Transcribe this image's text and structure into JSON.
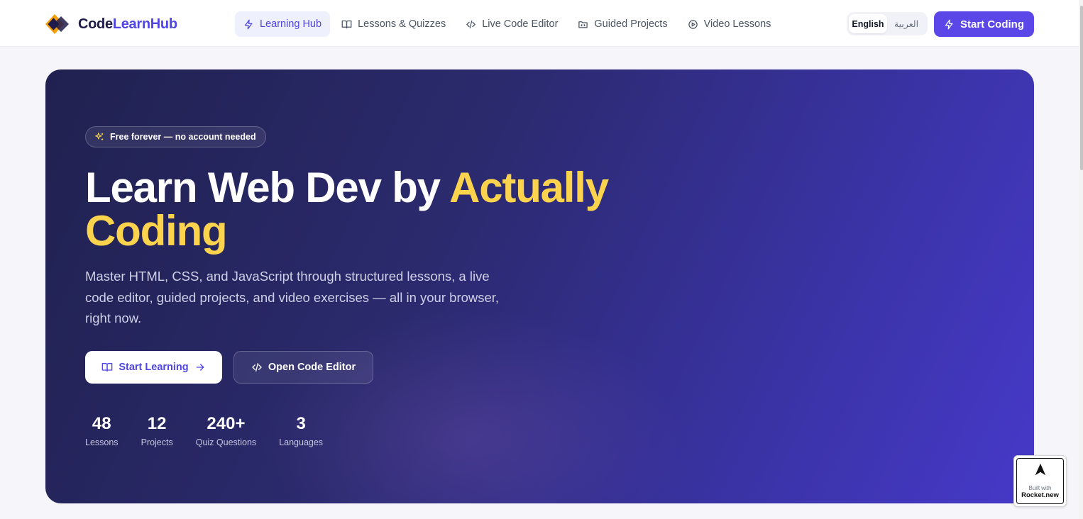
{
  "header": {
    "logo": {
      "part1": "Code",
      "part2": "LearnHub"
    },
    "nav": [
      {
        "label": "Learning Hub",
        "icon": "bolt-icon",
        "active": true
      },
      {
        "label": "Lessons & Quizzes",
        "icon": "book-open-icon",
        "active": false
      },
      {
        "label": "Live Code Editor",
        "icon": "code-icon",
        "active": false
      },
      {
        "label": "Guided Projects",
        "icon": "folder-code-icon",
        "active": false
      },
      {
        "label": "Video Lessons",
        "icon": "play-circle-icon",
        "active": false
      }
    ],
    "languages": {
      "english": "English",
      "arabic": "العربية",
      "selected": "English"
    },
    "cta_label": "Start Coding"
  },
  "hero": {
    "badge": "Free forever — no account needed",
    "title_line1": "Learn Web Dev by ",
    "title_highlight1": "Actually",
    "title_highlight2": "Coding",
    "subtitle": "Master HTML, CSS, and JavaScript through structured lessons, a live code editor, guided projects, and video exercises — all in your browser, right now.",
    "primary_button": "Start Learning",
    "secondary_button": "Open Code Editor",
    "stats": [
      {
        "value": "48",
        "label": "Lessons"
      },
      {
        "value": "12",
        "label": "Projects"
      },
      {
        "value": "240+",
        "label": "Quiz Questions"
      },
      {
        "value": "3",
        "label": "Languages"
      }
    ]
  },
  "widget": {
    "small": "Built with",
    "name": "Rocket.new"
  },
  "colors": {
    "accent": "#5b47e8",
    "highlight": "#fcd34d",
    "hero_start": "#20214f",
    "hero_end": "#4639c9"
  }
}
